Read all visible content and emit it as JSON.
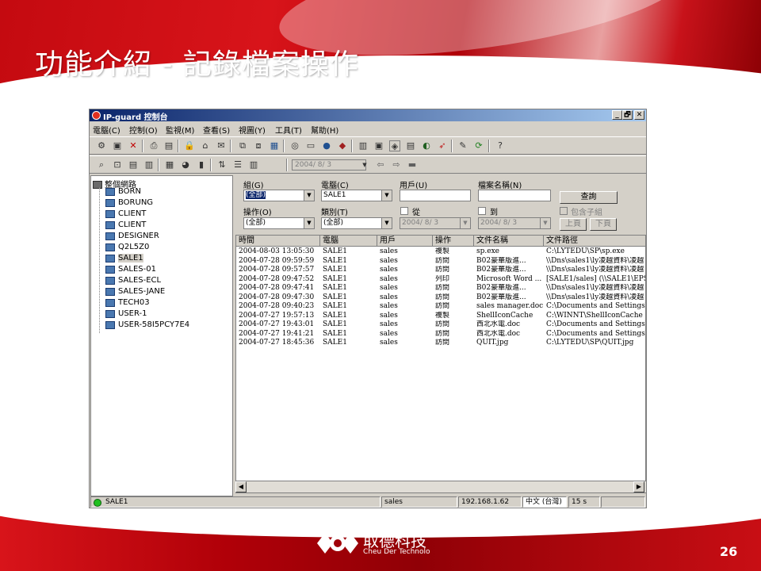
{
  "slide": {
    "title": "功能介紹 - 記錄檔案操作",
    "page_number": "26",
    "company_cn": "取德科技",
    "company_en": "Cheu Der Technolo"
  },
  "window": {
    "title": "IP-guard 控制台",
    "buttons": [
      "_",
      "🗗",
      "✕"
    ]
  },
  "menu": [
    "電腦(C)",
    "控制(O)",
    "監視(M)",
    "查看(S)",
    "視圖(Y)",
    "工具(T)",
    "幫助(H)"
  ],
  "toolbar2": {
    "date": "2004/ 8/ 3"
  },
  "tree": {
    "root": "整個網路",
    "nodes": [
      "BORN",
      "BORUNG",
      "CLIENT",
      "CLIENT",
      "DESIGNER",
      "Q2L5Z0",
      "SALE1",
      "SALES-01",
      "SALES-ECL",
      "SALES-JANE",
      "TECH03",
      "USER-1",
      "USER-58I5PCY7E4"
    ],
    "selected": "SALE1"
  },
  "filters": {
    "group_label": "組(G)",
    "group_value": "(全部)",
    "computer_label": "電腦(C)",
    "computer_value": "SALE1",
    "user_label": "用戶(U)",
    "filename_label": "檔案名稱(N)",
    "query_button": "查詢",
    "operation_label": "操作(O)",
    "operation_value": "(全部)",
    "category_label": "類別(T)",
    "category_value": "(全部)",
    "from_label": "從",
    "from_date": "2004/ 8/ 3",
    "to_label": "到",
    "to_date": "2004/ 8/ 3",
    "include_subgroups": "包含子組",
    "prev_button": "上頁",
    "next_button": "下頁"
  },
  "log": {
    "headers": [
      "時間",
      "電腦",
      "用戶",
      "操作",
      "文件名稱",
      "文件路徑"
    ],
    "rows": [
      [
        "2004-08-03 13:05:30",
        "SALE1",
        "sales",
        "複製",
        "sp.exe",
        "C:\\LYTEDU\\SP\\sp.exe"
      ],
      [
        "2004-07-28 09:59:59",
        "SALE1",
        "sales",
        "訪問",
        "B02豪華版進...",
        "\\\\Dns\\sales1\\ly凌越資料\\凌越"
      ],
      [
        "2004-07-28 09:57:57",
        "SALE1",
        "sales",
        "訪問",
        "B02豪華版進...",
        "\\\\Dns\\sales1\\ly凌越資料\\凌越"
      ],
      [
        "2004-07-28 09:47:52",
        "SALE1",
        "sales",
        "列印",
        "Microsoft Word ...",
        "[SALE1/sales] (\\\\SALE1\\EPSO"
      ],
      [
        "2004-07-28 09:47:41",
        "SALE1",
        "sales",
        "訪問",
        "B02豪華版進...",
        "\\\\Dns\\sales1\\ly凌越資料\\凌越"
      ],
      [
        "2004-07-28 09:47:30",
        "SALE1",
        "sales",
        "訪問",
        "B02豪華版進...",
        "\\\\Dns\\sales1\\ly凌越資料\\凌越"
      ],
      [
        "2004-07-28 09:40:23",
        "SALE1",
        "sales",
        "訪問",
        "sales manager.doc",
        "C:\\Documents and Settings\\sal"
      ],
      [
        "2004-07-27 19:57:13",
        "SALE1",
        "sales",
        "複製",
        "ShellIconCache",
        "C:\\WINNT\\ShellIconCache"
      ],
      [
        "2004-07-27 19:43:01",
        "SALE1",
        "sales",
        "訪問",
        "西北水電.doc",
        "C:\\Documents and Settings\\sal"
      ],
      [
        "2004-07-27 19:41:21",
        "SALE1",
        "sales",
        "訪問",
        "西北水電.doc",
        "C:\\Documents and Settings\\sal"
      ],
      [
        "2004-07-27 18:45:36",
        "SALE1",
        "sales",
        "訪問",
        "QUIT.jpg",
        "C:\\LYTEDU\\SP\\QUIT.jpg"
      ]
    ]
  },
  "status": {
    "computer": "SALE1",
    "user": "sales",
    "ip": "192.168.1.62",
    "ime": "中文 (台灣)",
    "interval": "15 s"
  },
  "colors": {
    "title_bar": "#0a246a",
    "slide_red": "#c40a10",
    "window_bg": "#d4d0c8"
  }
}
